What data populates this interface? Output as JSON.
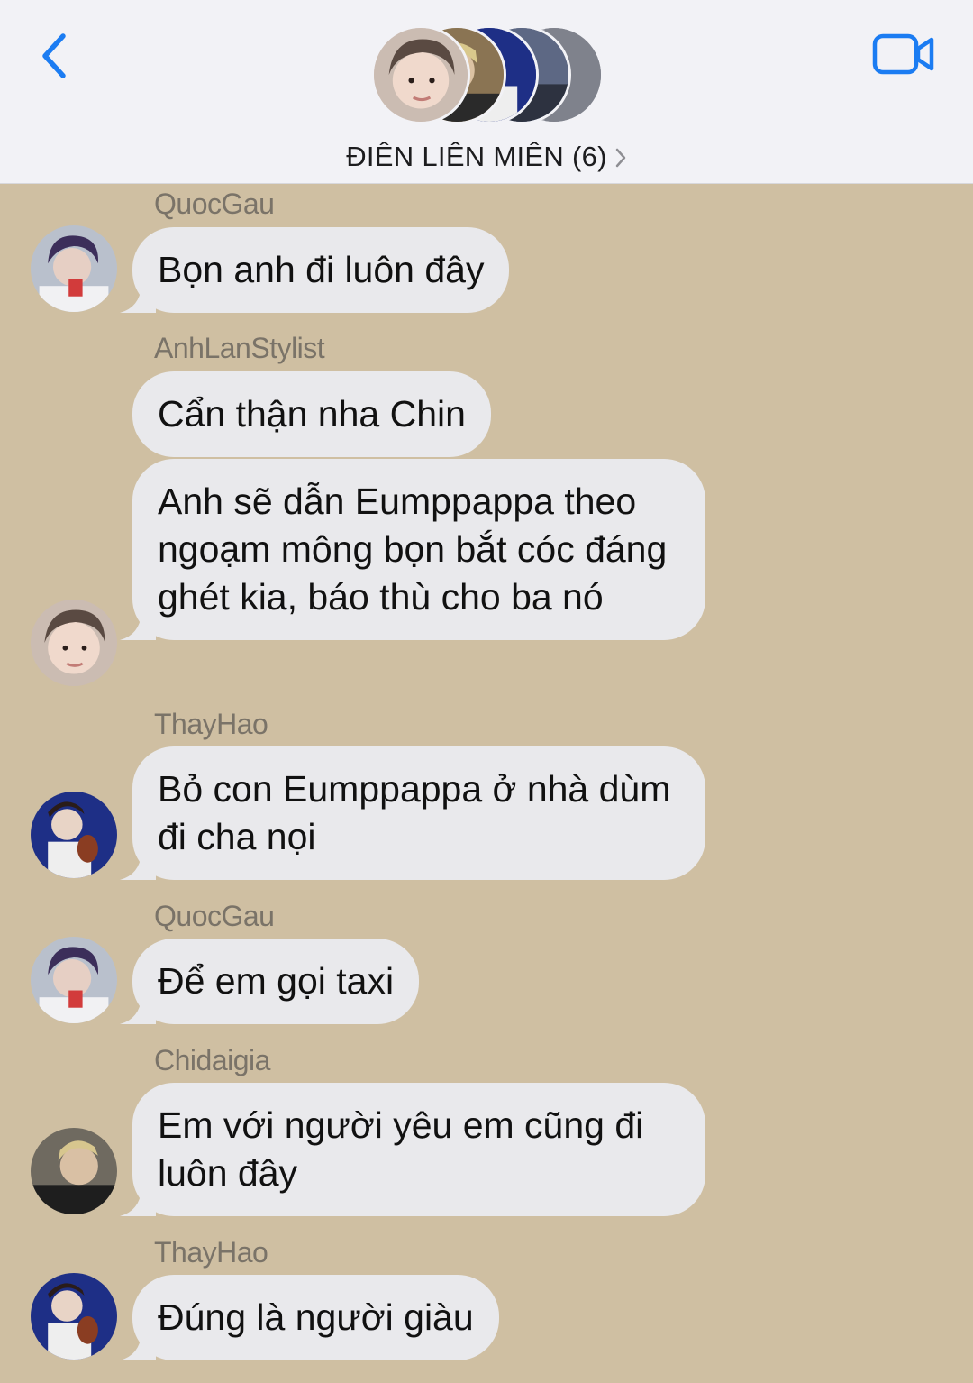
{
  "header": {
    "group_name": "ĐIÊN LIÊN MIÊN (6)",
    "back_icon": "chevron-left-icon",
    "video_icon": "video-camera-icon",
    "accent_color": "#1b7cf2"
  },
  "messages": [
    {
      "sender": "QuocGau",
      "text": "Bọn anh đi luôn đây"
    },
    {
      "sender": "AnhLanStylist",
      "text": "Cẩn thận nha Chin"
    },
    {
      "sender": "",
      "text": "Anh sẽ dẫn Eumppappa theo ngoạm mông bọn bắt cóc đáng ghét kia, báo thù cho ba nó"
    },
    {
      "sender": "ThayHao",
      "text": "Bỏ con Eumppappa ở nhà dùm đi cha nọi"
    },
    {
      "sender": "QuocGau",
      "text": "Để em gọi taxi"
    },
    {
      "sender": "Chidaigia",
      "text": "Em với người yêu em cũng đi luôn đây"
    },
    {
      "sender": "ThayHao",
      "text": "Đúng là người giàu"
    }
  ],
  "colors": {
    "background": "#cfbfa2",
    "bubble": "#e9e9ec",
    "sender_name": "#7a7368"
  }
}
